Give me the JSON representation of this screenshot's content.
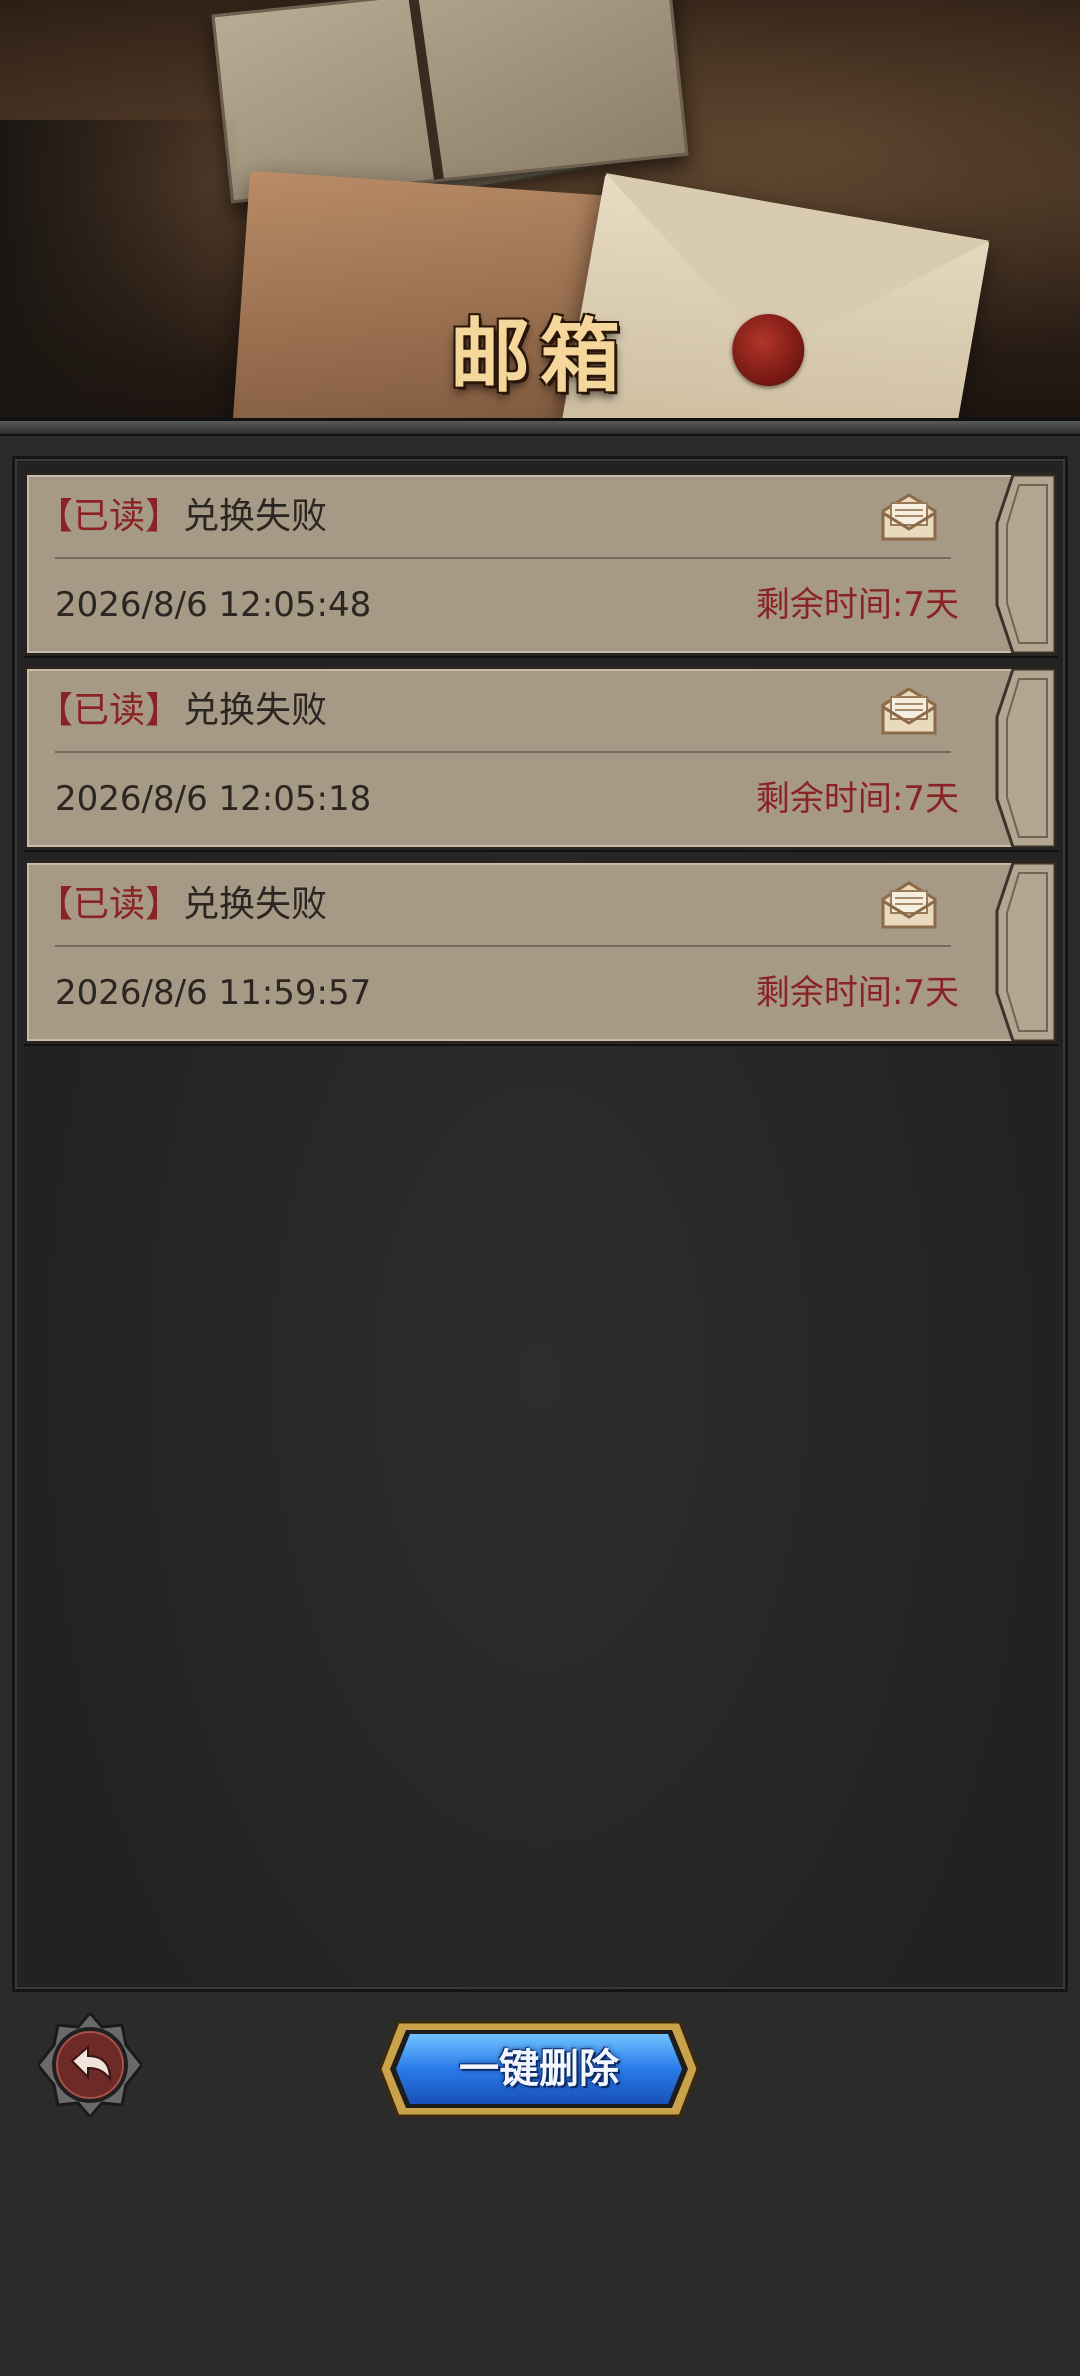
{
  "header": {
    "title": "邮箱"
  },
  "mails": [
    {
      "status": "【已读】",
      "subject": "兑换失败",
      "date": "2026/8/6  12:05:48",
      "remaining": "剩余时间:7天",
      "icon": "envelope-open-icon"
    },
    {
      "status": "【已读】",
      "subject": "兑换失败",
      "date": "2026/8/6  12:05:18",
      "remaining": "剩余时间:7天",
      "icon": "envelope-open-icon"
    },
    {
      "status": "【已读】",
      "subject": "兑换失败",
      "date": "2026/8/6  11:59:57",
      "remaining": "剩余时间:7天",
      "icon": "envelope-open-icon"
    }
  ],
  "footer": {
    "back_icon": "back-arrow-icon",
    "delete_all_label": "一键删除"
  },
  "colors": {
    "status_red": "#8a2323",
    "item_bg": "#a69985",
    "title_gold": "#f6d79b",
    "button_blue": "#1f6fe0"
  }
}
